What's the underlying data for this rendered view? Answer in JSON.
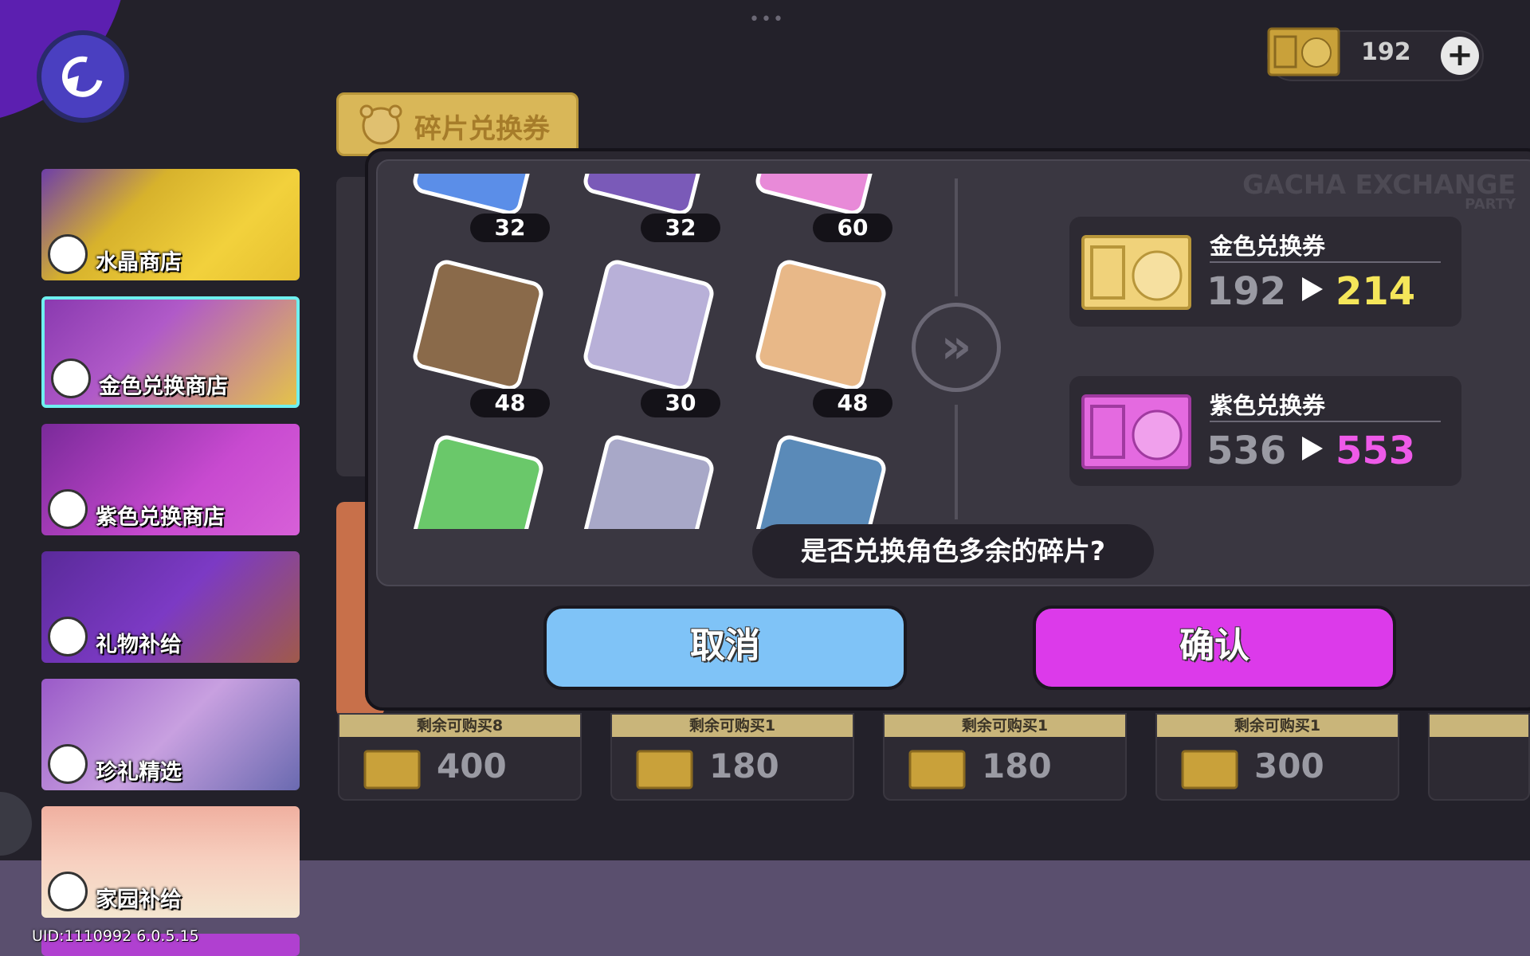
{
  "header": {
    "menu_dots": "•••",
    "currency_value": "192",
    "currency_plus": "+"
  },
  "sidebar": {
    "items": [
      {
        "label": "水晶商店"
      },
      {
        "label": "金色兑换商店"
      },
      {
        "label": "紫色兑换商店"
      },
      {
        "label": "礼物补给"
      },
      {
        "label": "珍礼精选"
      },
      {
        "label": "家园补给"
      }
    ],
    "uid": "UID:1110992 6.0.5.15"
  },
  "tab": {
    "label": "碎片兑换券"
  },
  "shop_cards": [
    {
      "remaining": "剩余可购买8",
      "price": "400"
    },
    {
      "remaining": "剩余可购买1",
      "price": "180"
    },
    {
      "remaining": "剩余可购买1",
      "price": "180"
    },
    {
      "remaining": "剩余可购买1",
      "price": "300"
    }
  ],
  "modal": {
    "watermark_title": "GACHA EXCHANGE",
    "watermark_sub": "PARTY",
    "fragments": [
      {
        "count": "32",
        "color": "#5b8ee8"
      },
      {
        "count": "32",
        "color": "#7a5ab8"
      },
      {
        "count": "60",
        "color": "#e88ad8"
      },
      {
        "count": "48",
        "color": "#8a6a4a"
      },
      {
        "count": "30",
        "color": "#b8b0d8"
      },
      {
        "count": "48",
        "color": "#e8b888"
      },
      {
        "count": "",
        "color": "#6ac86a"
      },
      {
        "count": "",
        "color": "#a8a8c8"
      },
      {
        "count": "",
        "color": "#5a8ab8"
      }
    ],
    "arrow": "»",
    "gold": {
      "name": "金色兑换券",
      "from": "192",
      "to": "214",
      "to_color": "#f5e65a"
    },
    "purple": {
      "name": "紫色兑换券",
      "from": "536",
      "to": "553",
      "to_color": "#ee5ae8"
    },
    "question": "是否兑换角色多余的碎片?",
    "cancel_label": "取消",
    "confirm_label": "确认"
  }
}
